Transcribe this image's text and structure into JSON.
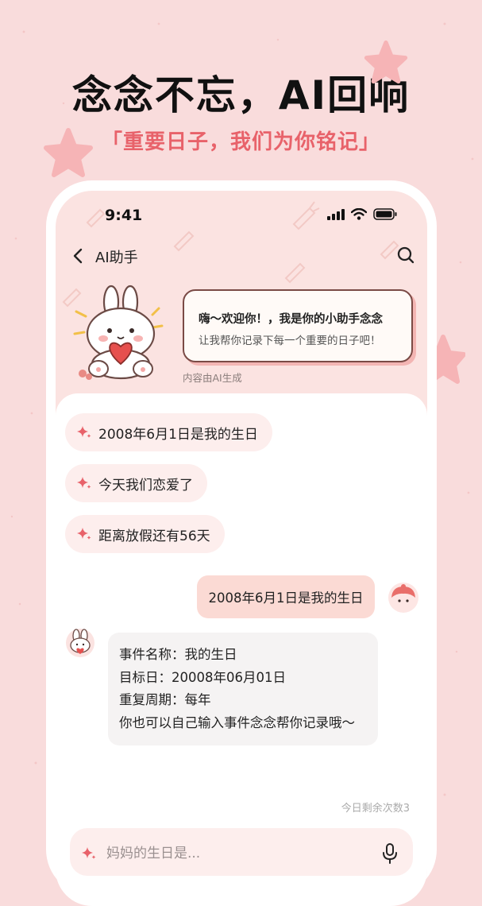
{
  "promo": {
    "headline": "念念不忘，AI回响",
    "subline": "「重要日子，我们为你铭记」"
  },
  "status_bar": {
    "time": "9:41"
  },
  "nav": {
    "title": "AI助手"
  },
  "greeting": {
    "line1": "嗨～欢迎你！，我是你的小助手念念",
    "line2": "让我帮你记录下每一个重要的日子吧！",
    "ai_note": "内容由AI生成"
  },
  "suggestions": [
    {
      "label": "2008年6月1日是我的生日"
    },
    {
      "label": "今天我们恋爱了"
    },
    {
      "label": "距离放假还有56天"
    }
  ],
  "chat": {
    "user_message": "2008年6月1日是我的生日",
    "ai_reply": {
      "line1": "事件名称：我的生日",
      "line2": "目标日：20008年06月01日",
      "line3": "重复周期：每年",
      "line4": "你也可以自己输入事件念念帮你记录哦～"
    }
  },
  "quota": "今日剩余次数3",
  "input": {
    "placeholder": "妈妈的生日是..."
  },
  "colors": {
    "accent": "#e8626a",
    "background": "#f9dcdc",
    "chip": "#fdeeed",
    "user_bubble": "#fbdad4"
  }
}
